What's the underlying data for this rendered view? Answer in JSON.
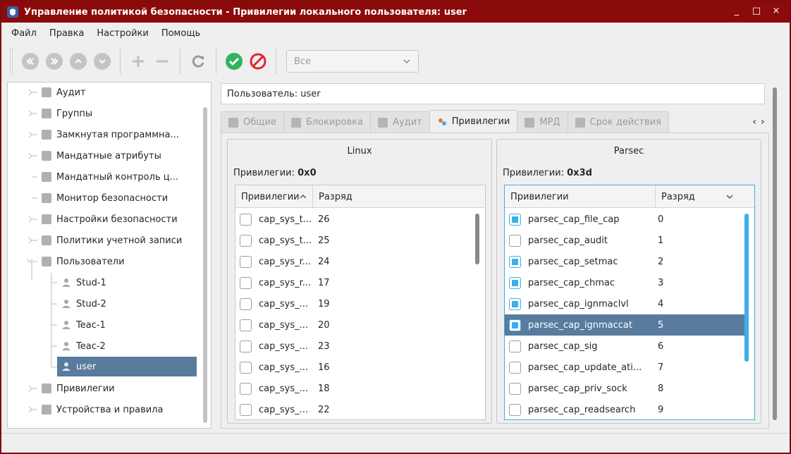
{
  "window": {
    "title": "Управление политикой безопасности - Привилегии локального пользователя: user",
    "controls": {
      "minimize": "_",
      "maximize": "□",
      "close": "×"
    }
  },
  "menu": [
    "Файл",
    "Правка",
    "Настройки",
    "Помощь"
  ],
  "toolbar": {
    "filter_value": "Все",
    "icons": [
      "back-icon",
      "forward-icon",
      "up-icon",
      "down-icon",
      "add-icon",
      "remove-icon",
      "refresh-icon",
      "apply-icon",
      "cancel-icon"
    ]
  },
  "tree": [
    {
      "label": "Аудит",
      "expandable": true
    },
    {
      "label": "Группы",
      "expandable": true
    },
    {
      "label": "Замкнутая программна...",
      "expandable": true
    },
    {
      "label": "Мандатные атрибуты",
      "expandable": true
    },
    {
      "label": "Мандатный контроль ц...",
      "expandable": false
    },
    {
      "label": "Монитор безопасности",
      "expandable": false
    },
    {
      "label": "Настройки безопасности",
      "expandable": true
    },
    {
      "label": "Политики учетной записи",
      "expandable": true
    },
    {
      "label": "Пользователи",
      "expandable": true,
      "expanded": true
    },
    {
      "label": "Stud-1",
      "child": true
    },
    {
      "label": "Stud-2",
      "child": true
    },
    {
      "label": "Teac-1",
      "child": true
    },
    {
      "label": "Teac-2",
      "child": true
    },
    {
      "label": "user",
      "child": true,
      "selected": true
    },
    {
      "label": "Привилегии",
      "expandable": true
    },
    {
      "label": "Устройства и правила",
      "expandable": true
    }
  ],
  "user_label": "Пользователь: user",
  "tabs": [
    "Общие",
    "Блокировка",
    "Аудит",
    "Привилегии",
    "МРД",
    "Срок действия"
  ],
  "active_tab": "Привилегии",
  "tab_arrows": {
    "left": "‹",
    "right": "›"
  },
  "linux": {
    "title": "Linux",
    "priv_label": "Привилегии: ",
    "priv_value": "0x0",
    "col_name": "Привилегии",
    "col_bit": "Разряд",
    "rows": [
      {
        "name": "cap_sys_t...",
        "bit": "26",
        "checked": false
      },
      {
        "name": "cap_sys_t...",
        "bit": "25",
        "checked": false
      },
      {
        "name": "cap_sys_r...",
        "bit": "24",
        "checked": false
      },
      {
        "name": "cap_sys_r...",
        "bit": "17",
        "checked": false
      },
      {
        "name": "cap_sys_...",
        "bit": "19",
        "checked": false
      },
      {
        "name": "cap_sys_...",
        "bit": "20",
        "checked": false
      },
      {
        "name": "cap_sys_...",
        "bit": "23",
        "checked": false
      },
      {
        "name": "cap_sys_...",
        "bit": "16",
        "checked": false
      },
      {
        "name": "cap_sys_...",
        "bit": "18",
        "checked": false
      },
      {
        "name": "cap_sys_...",
        "bit": "22",
        "checked": false
      }
    ]
  },
  "parsec": {
    "title": "Parsec",
    "priv_label": "Привилегии: ",
    "priv_value": "0x3d",
    "col_name": "Привилегии",
    "col_bit": "Разряд",
    "rows": [
      {
        "name": "parsec_cap_file_cap",
        "bit": "0",
        "checked": true
      },
      {
        "name": "parsec_cap_audit",
        "bit": "1",
        "checked": false
      },
      {
        "name": "parsec_cap_setmac",
        "bit": "2",
        "checked": true
      },
      {
        "name": "parsec_cap_chmac",
        "bit": "3",
        "checked": true
      },
      {
        "name": "parsec_cap_ignmaclvl",
        "bit": "4",
        "checked": true
      },
      {
        "name": "parsec_cap_ignmaccat",
        "bit": "5",
        "checked": true,
        "selected": true
      },
      {
        "name": "parsec_cap_sig",
        "bit": "6",
        "checked": false
      },
      {
        "name": "parsec_cap_update_ati...",
        "bit": "7",
        "checked": false
      },
      {
        "name": "parsec_cap_priv_sock",
        "bit": "8",
        "checked": false
      },
      {
        "name": "parsec_cap_readsearch",
        "bit": "9",
        "checked": false
      }
    ]
  },
  "colors": {
    "titlebar": "#8b0a0a",
    "selection": "#587b9e",
    "accent": "#3daee9",
    "ok": "#2fb55d",
    "cancel": "#e2262d"
  }
}
